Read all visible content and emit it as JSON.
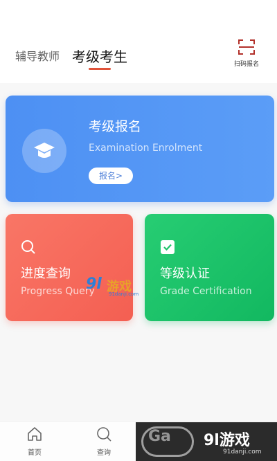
{
  "header": {
    "tabs": [
      {
        "label": "辅导教师",
        "active": false
      },
      {
        "label": "考级考生",
        "active": true
      }
    ],
    "scan_label": "扫码报名"
  },
  "cards": {
    "enrolment": {
      "title": "考级报名",
      "subtitle": "Examination Enrolment",
      "button": "报名>",
      "icon": "graduation-cap-icon",
      "color": "#4d90f3"
    },
    "progress": {
      "title": "进度查询",
      "subtitle": "Progress Query",
      "icon": "search-icon",
      "color": "#f46a5a"
    },
    "certification": {
      "title": "等级认证",
      "subtitle": "Grade Certification",
      "icon": "checkbox-icon",
      "color": "#1dc268"
    }
  },
  "bottom_nav": [
    {
      "label": "首页",
      "icon": "home-icon"
    },
    {
      "label": "查询",
      "icon": "search-icon"
    }
  ],
  "watermark": {
    "logo": "9l",
    "brand": "游戏",
    "url": "91danji.com"
  },
  "corner_brand": {
    "ring_text": "Ga",
    "logo": "9l游戏",
    "url": "91danji.com"
  },
  "accent_color": "#e0533a"
}
